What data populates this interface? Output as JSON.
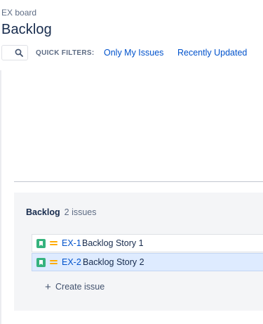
{
  "header": {
    "board_name": "EX board",
    "title": "Backlog"
  },
  "filters": {
    "search_placeholder": "",
    "label": "QUICK FILTERS:",
    "items": [
      {
        "label": "Only My Issues"
      },
      {
        "label": "Recently Updated"
      }
    ]
  },
  "backlog": {
    "title": "Backlog",
    "count": "2 issues",
    "issues": [
      {
        "key": "EX-1",
        "summary": "Backlog Story 1",
        "type_icon": "story-icon",
        "priority_icon": "priority-medium-icon",
        "selected": false
      },
      {
        "key": "EX-2",
        "summary": "Backlog Story 2",
        "type_icon": "story-icon",
        "priority_icon": "priority-medium-icon",
        "selected": true
      }
    ],
    "create_label": "Create issue"
  },
  "colors": {
    "link": "#0052cc",
    "story": "#36b37e",
    "priority_medium": "#ffab00",
    "selected_row": "#deebff",
    "panel_bg": "#f4f5f7"
  }
}
